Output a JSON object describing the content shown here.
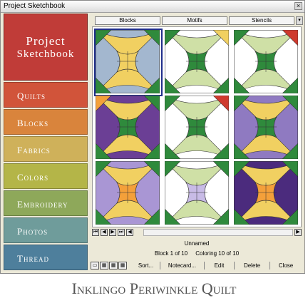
{
  "window": {
    "title": "Project Sketchbook",
    "close_glyph": "×"
  },
  "sidebar": {
    "logo_line1": "Project",
    "logo_line2": "Sketchbook",
    "items": [
      {
        "label": "Quilts",
        "color": "#d1543a"
      },
      {
        "label": "Blocks",
        "color": "#d9843c"
      },
      {
        "label": "Fabrics",
        "color": "#cfb15a"
      },
      {
        "label": "Colors",
        "color": "#b4b548"
      },
      {
        "label": "Embroidery",
        "color": "#8ea85a"
      },
      {
        "label": "Photos",
        "color": "#6f9c9b"
      },
      {
        "label": "Thread",
        "color": "#4e7f9c"
      }
    ]
  },
  "tabs": [
    {
      "label": "Blocks",
      "active": true
    },
    {
      "label": "Motifs",
      "active": false
    },
    {
      "label": "Stencils",
      "active": false
    }
  ],
  "tab_menu_glyph": "▾",
  "blocks": [
    {
      "bg": "#a3b7cf",
      "center": "#f1d061",
      "corners": [
        "#2f8a3c",
        "#2f8a3c",
        "#2f8a3c",
        "#2f8a3c"
      ],
      "arcs": "#f1d061",
      "selected": true
    },
    {
      "bg": "#ffffff",
      "center": "#2f8a3c",
      "corners": [
        "#2f8a3c",
        "#f1d061",
        "#2f8a3c",
        "#2f8a3c"
      ],
      "arcs": "#cfe0a6",
      "selected": false
    },
    {
      "bg": "#ffffff",
      "center": "#2f8a3c",
      "corners": [
        "#2f8a3c",
        "#cf3a2e",
        "#2f8a3c",
        "#2f8a3c"
      ],
      "arcs": "#cfe0a6",
      "selected": false
    },
    {
      "bg": "#6b3f95",
      "center": "#2f8a3c",
      "corners": [
        "#f4a03a",
        "#2f8a3c",
        "#2f8a3c",
        "#2f8a3c"
      ],
      "arcs": "#f1d061",
      "selected": false
    },
    {
      "bg": "#ffffff",
      "center": "#2f8a3c",
      "corners": [
        "#2f8a3c",
        "#cf3a2e",
        "#2f8a3c",
        "#2f8a3c"
      ],
      "arcs": "#cfe0a6",
      "selected": false
    },
    {
      "bg": "#8f7ac1",
      "center": "#2f8a3c",
      "corners": [
        "#2f8a3c",
        "#2f8a3c",
        "#2f8a3c",
        "#2f8a3c"
      ],
      "arcs": "#f1d061",
      "selected": false
    },
    {
      "bg": "#a996d4",
      "center": "#f4a03a",
      "corners": [
        "#2f8a3c",
        "#2f8a3c",
        "#2f8a3c",
        "#2f8a3c"
      ],
      "arcs": "#f1d061",
      "selected": false
    },
    {
      "bg": "#ffffff",
      "center": "#c8bbe6",
      "corners": [
        "#2f8a3c",
        "#2f8a3c",
        "#2f8a3c",
        "#2f8a3c"
      ],
      "arcs": "#cfe0a6",
      "selected": false
    },
    {
      "bg": "#4b2b7d",
      "center": "#f4a03a",
      "corners": [
        "#2f8a3c",
        "#2f8a3c",
        "#2f8a3c",
        "#2f8a3c"
      ],
      "arcs": "#f1d061",
      "selected": false
    }
  ],
  "nav_buttons": [
    "⏮",
    "◀",
    "▶",
    "⏭",
    "◀",
    "▶"
  ],
  "status": {
    "name": "Unnamed",
    "block_text": "Block 1 of 10",
    "coloring_text": "Coloring 10 of 10"
  },
  "view_buttons": [
    "▭",
    "▦",
    "▦",
    "▦"
  ],
  "toolbar": [
    {
      "label": "Sort..."
    },
    {
      "label": "Notecard..."
    },
    {
      "label": "Edit"
    },
    {
      "label": "Delete"
    },
    {
      "label": "Close"
    }
  ],
  "caption": "Inklingo Periwinkle Quilt"
}
